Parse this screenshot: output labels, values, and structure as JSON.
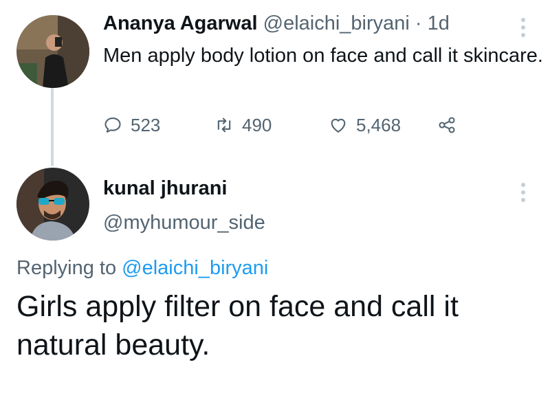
{
  "tweet": {
    "author_name": "Ananya Agarwal",
    "author_handle": "@elaichi_biryani",
    "separator": "·",
    "time": "1d",
    "text": "Men apply body lotion on face and call it skincare.",
    "replies_count": "523",
    "retweets_count": "490",
    "likes_count": "5,468",
    "icons": {
      "reply": "reply-icon",
      "retweet": "retweet-icon",
      "like": "heart-icon",
      "share": "share-icon",
      "more": "more-icon"
    }
  },
  "reply": {
    "author_name": "kunal jhurani",
    "author_handle": "@myhumour_side",
    "replying_prefix": "Replying to",
    "replying_to": "@elaichi_biryani",
    "text": "Girls apply filter on face and call it natural beauty."
  },
  "colors": {
    "text": "#0f1419",
    "secondary": "#536471",
    "link": "#1d9bf0",
    "thread_line": "#cfd9de"
  }
}
